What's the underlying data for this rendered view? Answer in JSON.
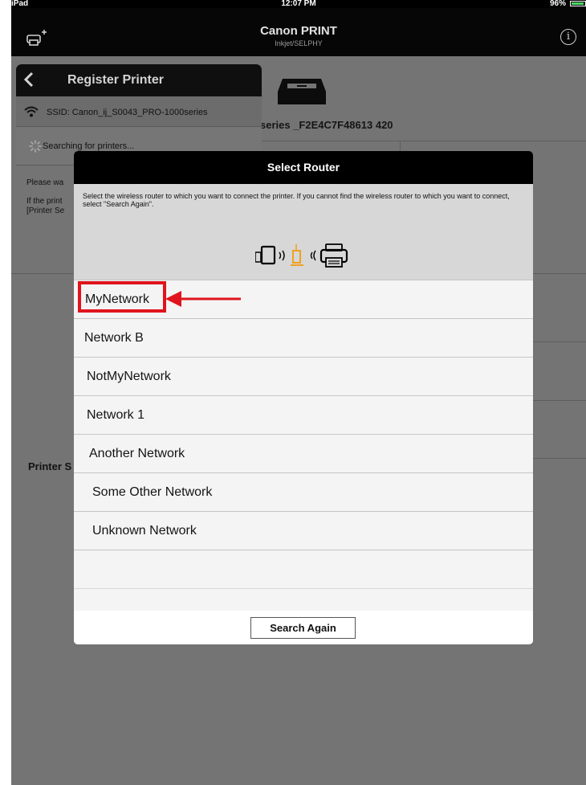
{
  "status_bar": {
    "carrier": "iPad",
    "time": "12:07 PM",
    "battery": "96%"
  },
  "app_header": {
    "title": "Canon PRINT",
    "subtitle": "Inkjet/SELPHY",
    "add_printer_icon": "printer-plus-icon",
    "info_icon": "info-icon",
    "info_glyph": "i"
  },
  "background": {
    "printer_name": "420 series _F2E4C7F48613",
    "panel": {
      "title": "Register Printer",
      "ssid": "SSID: Canon_ij_S0043_PRO-1000series",
      "searching": "Searching for printers...",
      "please_wait": "Please wa",
      "if_printer": "If the print\n[Printer Se"
    },
    "printer_settings": "Printer S"
  },
  "modal": {
    "title": "Select Router",
    "description": "Select the wireless router to which you want to connect the printer. If you cannot find the wireless router to which you want to connect, select \"Search Again\".",
    "networks": [
      {
        "name": "MyNetwork"
      },
      {
        "name": "Network B"
      },
      {
        "name": "NotMyNetwork"
      },
      {
        "name": "Network 1"
      },
      {
        "name": "Another Network"
      },
      {
        "name": "Some Other Network"
      },
      {
        "name": "Unknown Network"
      }
    ],
    "search_again": "Search Again"
  },
  "colors": {
    "highlight": "#e0141c",
    "router_orange": "#f0a020",
    "overlay_gray": "#747474"
  }
}
